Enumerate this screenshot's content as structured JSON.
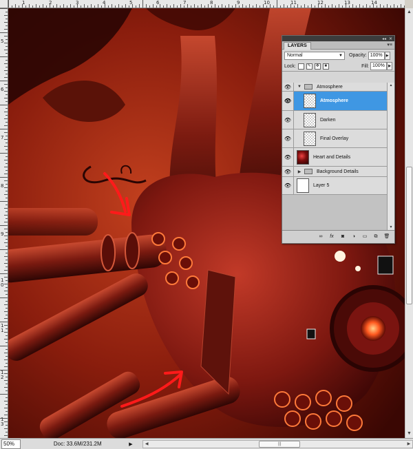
{
  "status": {
    "zoom": "50%",
    "doc": "Doc: 33.6M/231.2M"
  },
  "ruler": {
    "top_numbers": [
      "1",
      "2",
      "3",
      "4",
      "5",
      "6",
      "7",
      "8",
      "9",
      "10",
      "11",
      "12",
      "13",
      "14"
    ],
    "left_numbers": [
      "5",
      "6",
      "7",
      "8",
      "9",
      "10",
      "11",
      "12",
      "13",
      "14"
    ]
  },
  "layers_panel": {
    "tab": "LAYERS",
    "blend_mode": "Normal",
    "opacity_label": "Opacity:",
    "opacity": "100%",
    "lock_label": "Lock:",
    "fill_label": "Fill:",
    "fill": "100%",
    "layers": [
      {
        "name": "Atmosphere",
        "type": "group",
        "expanded": true
      },
      {
        "name": "Atmosphere",
        "type": "layer",
        "selected": true
      },
      {
        "name": "Darken",
        "type": "layer"
      },
      {
        "name": "Final Overlay",
        "type": "layer"
      },
      {
        "name": "Heart and Details",
        "type": "layer"
      },
      {
        "name": "Background Details",
        "type": "group",
        "expanded": false
      },
      {
        "name": "Layer 5",
        "type": "layer"
      }
    ],
    "bottom_icons": [
      "link-icon",
      "fx-icon",
      "mask-icon",
      "adjustment-icon",
      "folder-icon",
      "new-layer-icon",
      "trash-icon"
    ]
  },
  "colors": {
    "selected_layer": "#3f97e3",
    "canvas_base": "#6e1408",
    "annotation_arrows": "#ff1a1a"
  }
}
